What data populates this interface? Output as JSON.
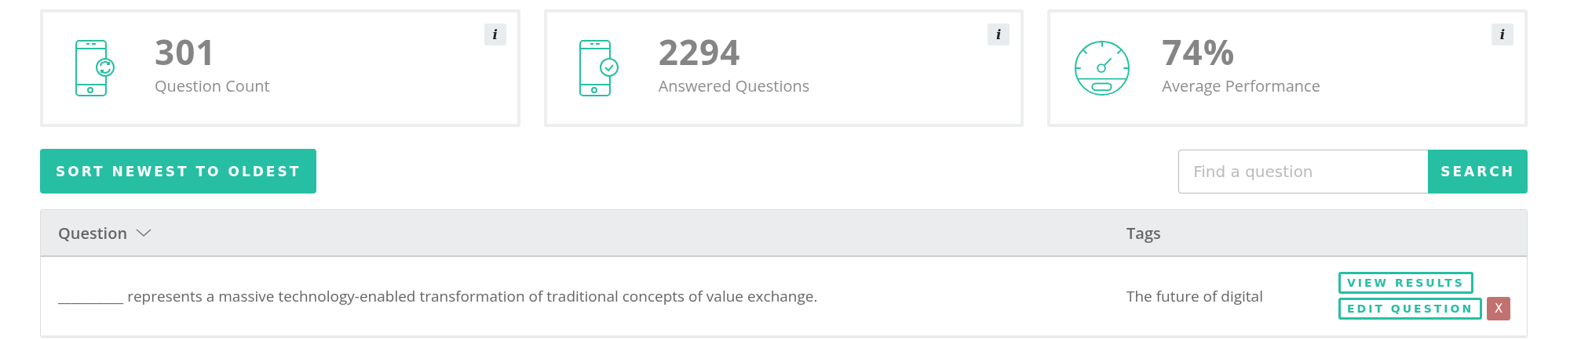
{
  "stats": [
    {
      "kind": "phone-sync",
      "value": "301",
      "label": "Question Count",
      "info": "i"
    },
    {
      "kind": "phone-check",
      "value": "2294",
      "label": "Answered Questions",
      "info": "i"
    },
    {
      "kind": "gauge",
      "value": "74%",
      "label": "Average Performance",
      "info": "i"
    }
  ],
  "sort_button": "SORT NEWEST TO OLDEST",
  "search": {
    "placeholder": "Find a question",
    "button": "SEARCH"
  },
  "table": {
    "columns": [
      {
        "label": "Question",
        "sorted": true
      },
      {
        "label": "Tags",
        "sorted": false
      }
    ],
    "rows": [
      {
        "question": "__________ represents a massive technology-enabled transformation of traditional concepts of value exchange.",
        "tags": "The future of digital",
        "actions": [
          "VIEW RESULTS",
          "EDIT QUESTION"
        ],
        "delete": "X"
      }
    ]
  }
}
